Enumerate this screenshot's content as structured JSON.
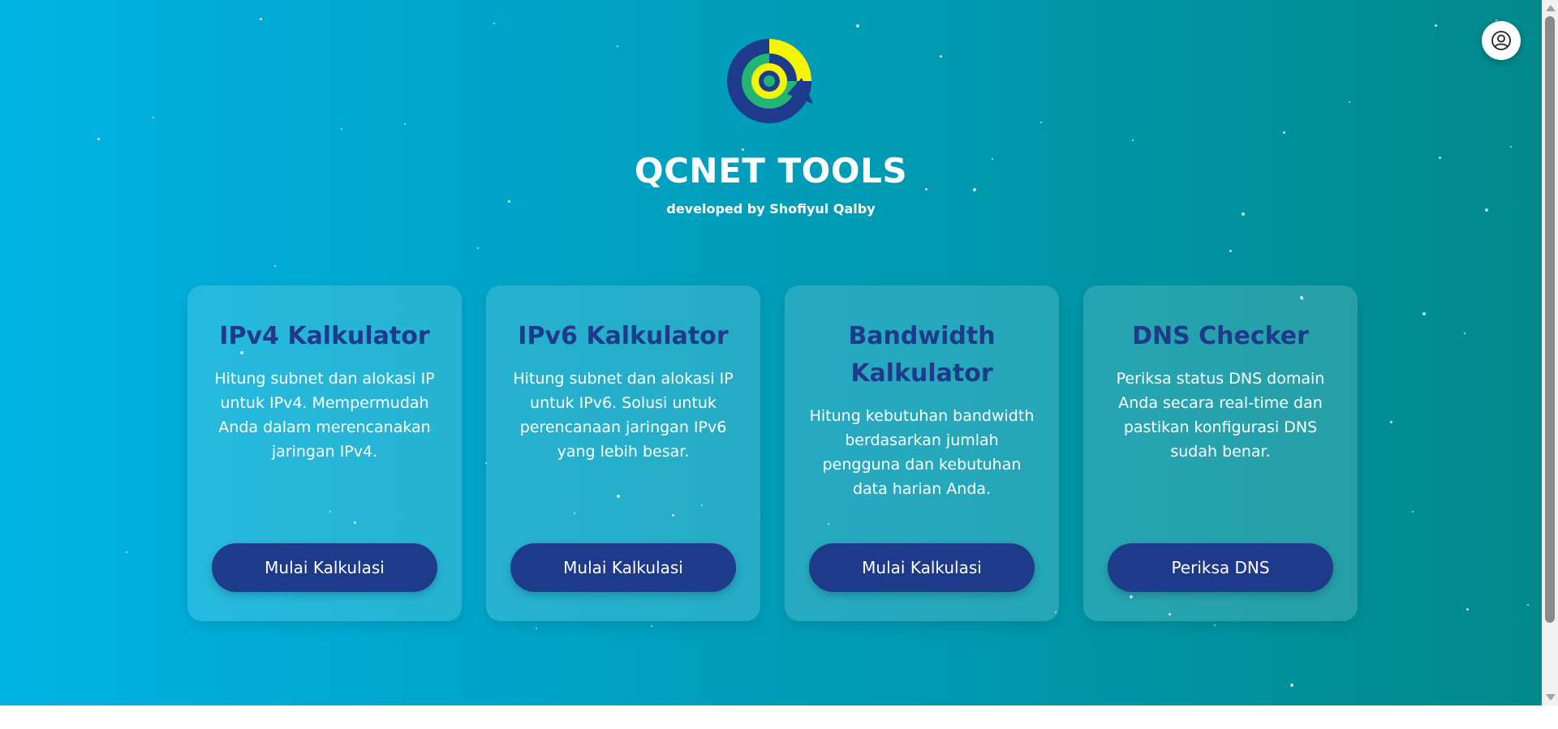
{
  "app": {
    "title": "QCNET TOOLS",
    "subtitle": "developed by Shofiyul Qalby"
  },
  "header": {
    "logo_icon": "qcnet-logo-icon",
    "profile_icon": "user-circle-icon"
  },
  "cards": [
    {
      "title": "IPv4 Kalkulator",
      "description": "Hitung subnet dan alokasi IP untuk IPv4. Mempermudah Anda dalam merencanakan jaringan IPv4.",
      "button_label": "Mulai Kalkulasi"
    },
    {
      "title": "IPv6 Kalkulator",
      "description": "Hitung subnet dan alokasi IP untuk IPv6. Solusi untuk perencanaan jaringan IPv6 yang lebih besar.",
      "button_label": "Mulai Kalkulasi"
    },
    {
      "title": "Bandwidth Kalkulator",
      "description": "Hitung kebutuhan bandwidth berdasarkan jumlah pengguna dan kebutuhan data harian Anda.",
      "button_label": "Mulai Kalkulasi"
    },
    {
      "title": "DNS Checker",
      "description": "Periksa status DNS domain Anda secara real-time dan pastikan konfigurasi DNS sudah benar.",
      "button_label": "Periksa DNS"
    }
  ],
  "colors": {
    "gradient_start": "#00b3e3",
    "gradient_end": "#008a8c",
    "accent": "#1e3a8a",
    "logo_yellow": "#f5f500",
    "logo_green": "#22b573"
  }
}
